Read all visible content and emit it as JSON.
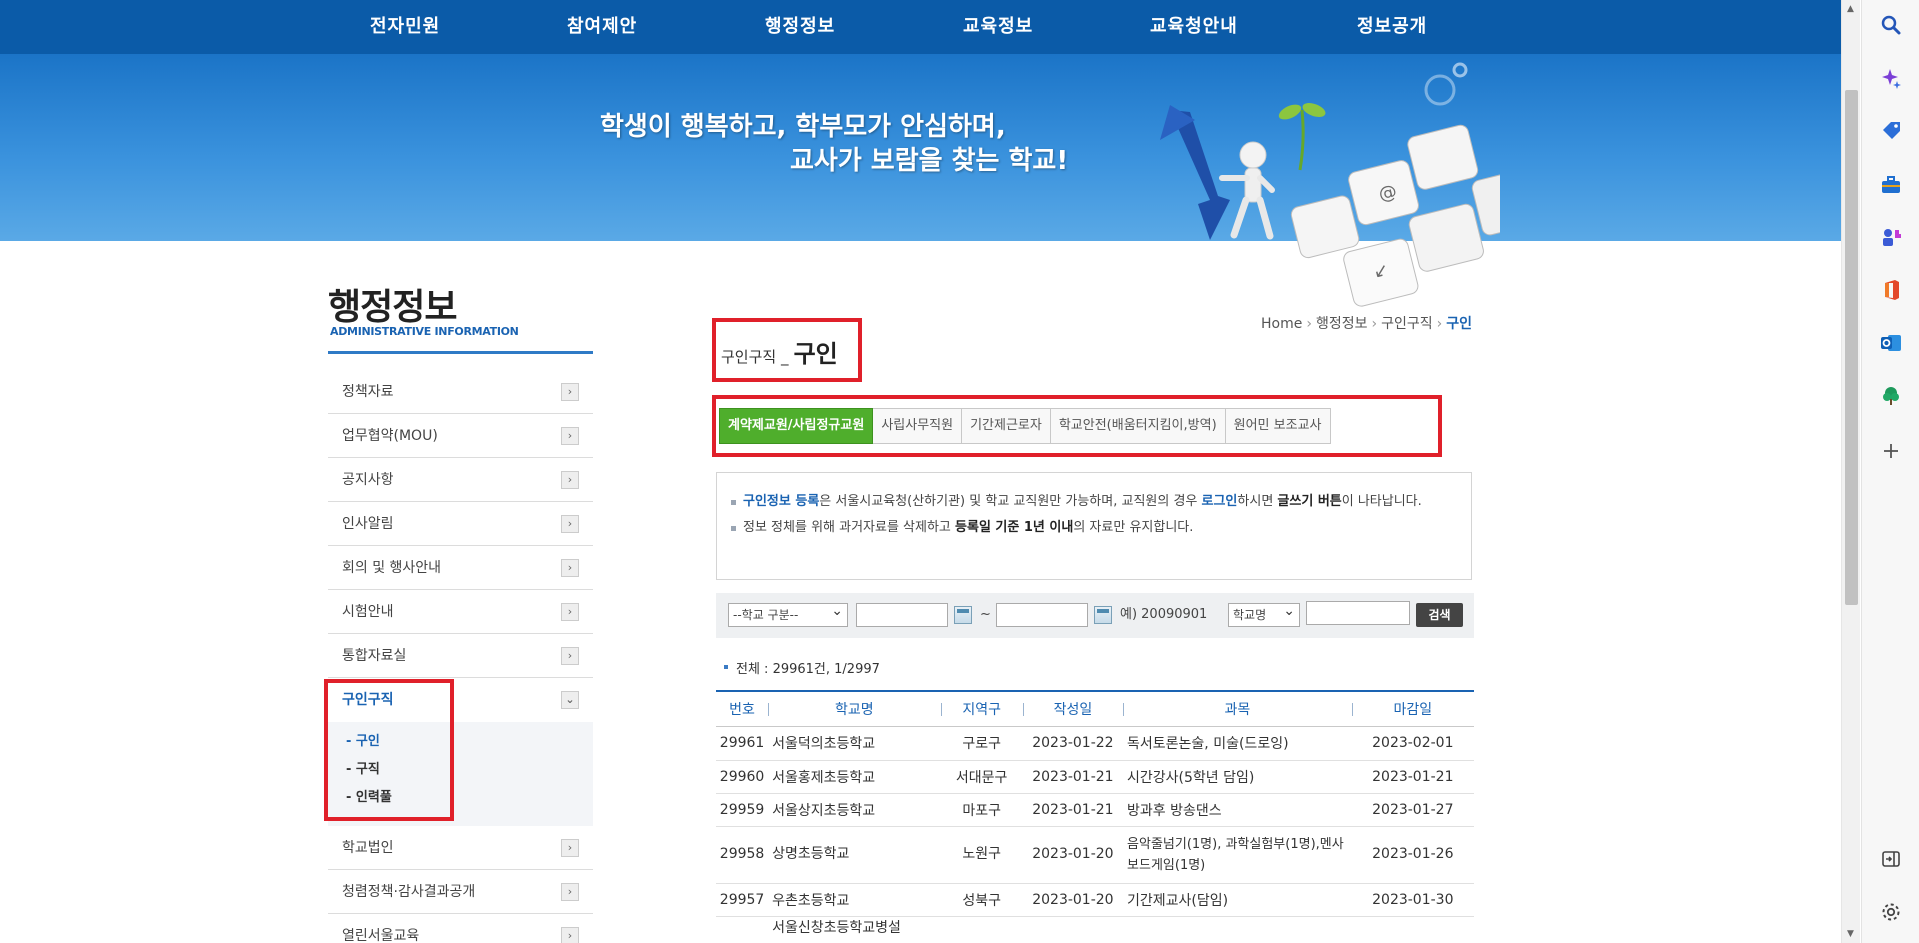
{
  "topnav": {
    "items": [
      "전자민원",
      "참여제안",
      "행정정보",
      "교육정보",
      "교육청안내",
      "정보공개"
    ]
  },
  "banner": {
    "slogan_line1": "학생이 행복하고, 학부모가 안심하며,",
    "slogan_line2": "교사가 보람을 찾는 학교!"
  },
  "sidebar": {
    "title": "행정정보",
    "subtitle": "ADMINISTRATIVE INFORMATION",
    "items": [
      {
        "label": "정책자료"
      },
      {
        "label": "업무협약(MOU)"
      },
      {
        "label": "공지사항"
      },
      {
        "label": "인사알림"
      },
      {
        "label": "회의 및 행사안내"
      },
      {
        "label": "시험안내"
      },
      {
        "label": "통합자료실"
      },
      {
        "label": "구인구직"
      },
      {
        "label": "학교법인"
      },
      {
        "label": "청렴정책·감사결과공개"
      },
      {
        "label": "열린서울교육"
      }
    ],
    "sub_items": [
      "- 구인",
      "- 구직",
      "- 인력풀"
    ],
    "arrow": "›",
    "arrow_open": "⌄"
  },
  "breadcrumb": {
    "home": "Home",
    "level1": "행정정보",
    "level2": "구인구직",
    "current": "구인",
    "separator": "›"
  },
  "page_title": {
    "prefix": "구인구직 _",
    "main": "구인"
  },
  "tabs": [
    "계약제교원/사립정규교원",
    "사립사무직원",
    "기간제근로자",
    "학교안전(배움터지킴이,방역)",
    "원어민 보조교사"
  ],
  "notice": {
    "line1_b1": "구인정보 등록",
    "line1_t1": "은 서울시교육청(산하기관) 및 학교 교직원만 가능하며, 교직원의 경우 ",
    "line1_b2": "로그인",
    "line1_t2": "하시면 ",
    "line1_b3": "글쓰기 버튼",
    "line1_t3": "이 나타납니다.",
    "line2_t1": "정보 정체를 위해 과거자료를 삭제하고 ",
    "line2_b1": "등록일 기준 1년 이내",
    "line2_t2": "의 자료만 유지합니다."
  },
  "search": {
    "school_type": "--학교 구분--",
    "tilde": "~",
    "example": "예) 20090901",
    "field_select": "학교명",
    "button": "검색"
  },
  "total": "전체 : 29961건, 1/2997",
  "table": {
    "headers": [
      "번호",
      "학교명",
      "지역구",
      "작성일",
      "과목",
      "마감일"
    ],
    "rows": [
      {
        "no": "29961",
        "school": "서울덕의초등학교",
        "district": "구로구",
        "written": "2023-01-22",
        "subject": "독서토론논술, 미술(드로잉)",
        "deadline": "2023-02-01"
      },
      {
        "no": "29960",
        "school": "서울홍제초등학교",
        "district": "서대문구",
        "written": "2023-01-21",
        "subject": "시간강사(5학년 담임)",
        "deadline": "2023-01-21"
      },
      {
        "no": "29959",
        "school": "서울상지초등학교",
        "district": "마포구",
        "written": "2023-01-21",
        "subject": "방과후 방송댄스",
        "deadline": "2023-01-27"
      },
      {
        "no": "29958",
        "school": "상명초등학교",
        "district": "노원구",
        "written": "2023-01-20",
        "subject": "음악줄넘기(1명), 과학실험부(1명),멘사보드게임(1명)",
        "deadline": "2023-01-26"
      },
      {
        "no": "29957",
        "school": "우촌초등학교",
        "district": "성북구",
        "written": "2023-01-20",
        "subject": "기간제교사(담임)",
        "deadline": "2023-01-30"
      },
      {
        "no": "",
        "school": "서울신창초등학교병설",
        "district": "",
        "written": "",
        "subject": "",
        "deadline": ""
      }
    ]
  },
  "colors": {
    "nav_blue": "#0b5ba8",
    "tab_green": "#4fae2c",
    "link_blue": "#1a63b2",
    "highlight_red": "#e0202a"
  },
  "edge_icons": [
    "search-icon",
    "copilot-icon",
    "tag-icon",
    "briefcase-icon",
    "games-icon",
    "office-icon",
    "outlook-icon",
    "tree-icon",
    "plus-icon",
    "panel-icon",
    "settings-icon"
  ]
}
